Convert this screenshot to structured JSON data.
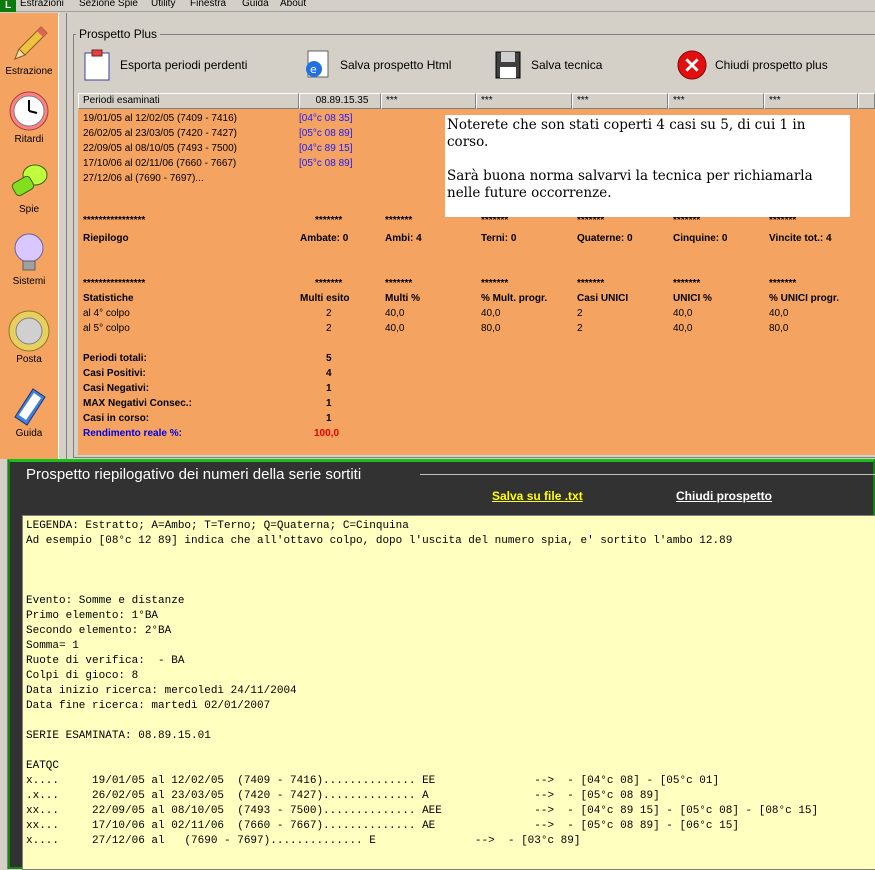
{
  "menu": {
    "items": [
      "Estrazioni",
      "Sezione Spie",
      "Utility",
      "Finestra",
      "Guida",
      "About"
    ]
  },
  "sidebar": {
    "items": [
      {
        "label": "Estrazione",
        "icon": "pencil-icon"
      },
      {
        "label": "Ritardi",
        "icon": "clock-icon"
      },
      {
        "label": "Spie",
        "icon": "flashlight-icon"
      },
      {
        "label": "Sistemi",
        "icon": "lightbulb-icon"
      },
      {
        "label": "Posta",
        "icon": "coin-icon"
      },
      {
        "label": "Guida",
        "icon": "book-icon"
      }
    ]
  },
  "prospetto": {
    "title": "Prospetto Plus",
    "toolbar": {
      "export_label": "Esporta periodi perdenti",
      "save_html_label": "Salva prospetto Html",
      "save_tech_label": "Salva tecnica",
      "close_label": "Chiudi prospetto plus"
    },
    "headers": [
      "Periodi esaminati",
      "08.89.15.35",
      "***",
      "***",
      "***",
      "***",
      "***"
    ],
    "periods": [
      {
        "range": "19/01/05 al 12/02/05  (7409 - 7416)",
        "result": "[04°c 08 35]"
      },
      {
        "range": "26/02/05 al 23/03/05  (7420 - 7427)",
        "result": "[05°c 08 89]"
      },
      {
        "range": "22/09/05 al 08/10/05  (7493 - 7500)",
        "result": "[04°c 89 15]"
      },
      {
        "range": "17/10/06 al 02/11/06  (7660 - 7667)",
        "result": "[05°c 08 89]"
      },
      {
        "range": "27/12/06 al    (7690 - 7697)...",
        "result": ""
      }
    ],
    "note": {
      "line1": "Noterete che son stati coperti 4 casi su 5, di cui 1 in corso.",
      "line2": "Sarà buona norma salvarvi la tecnica per richiamarla nelle future occorrenze."
    },
    "stars_long": "****************",
    "stars_short": "*******",
    "riepilogo": {
      "label": "Riepilogo",
      "ambate": "Ambate: 0",
      "ambi": "Ambi: 4",
      "terni": "Terni: 0",
      "quaterne": "Quaterne: 0",
      "cinquine": "Cinquine: 0",
      "vincite": "Vincite tot.: 4"
    },
    "statistiche": {
      "headers": [
        "Statistiche",
        "Multi esito",
        "Multi %",
        "% Mult. progr.",
        "Casi UNICI",
        "UNICI %",
        "% UNICI progr."
      ],
      "rows": [
        [
          "al 4° colpo",
          "2",
          "40,0",
          "40,0",
          "2",
          "40,0",
          "40,0"
        ],
        [
          "al 5° colpo",
          "2",
          "40,0",
          "80,0",
          "2",
          "40,0",
          "80,0"
        ]
      ]
    },
    "totals": [
      {
        "label": "Periodi totali:",
        "value": "5"
      },
      {
        "label": "Casi Positivi:",
        "value": "4"
      },
      {
        "label": "Casi Negativi:",
        "value": "1"
      },
      {
        "label": "MAX Negativi Consec.:",
        "value": "1"
      },
      {
        "label": "Casi in corso:",
        "value": "1"
      }
    ],
    "rendimento": {
      "label": "Rendimento reale %:",
      "value": "100,0"
    }
  },
  "riepilogativo": {
    "title": "Prospetto riepilogativo dei numeri della serie sortiti",
    "save_label": "Salva su file .txt",
    "close_label": "Chiudi prospetto",
    "text": "LEGENDA: Estratto; A=Ambo; T=Terno; Q=Quaterna; C=Cinquina\nAd esempio [08°c 12 89] indica che all'ottavo colpo, dopo l'uscita del numero spia, e' sortito l'ambo 12.89\n\n\n\nEvento: Somme e distanze\nPrimo elemento: 1°BA\nSecondo elemento: 2°BA\nSomma= 1\nRuote di verifica:  - BA\nColpi di gioco: 8\nData inizio ricerca: mercoledì 24/11/2004\nData fine ricerca: martedì 02/01/2007\n\nSERIE ESAMINATA: 08.89.15.01\n\nEATQC\nx....     19/01/05 al 12/02/05  (7409 - 7416).............. EE               -->  - [04°c 08] - [05°c 01]\n.x...     26/02/05 al 23/03/05  (7420 - 7427).............. A                -->  - [05°c 08 89]\nxx...     22/09/05 al 08/10/05  (7493 - 7500).............. AEE              -->  - [04°c 89 15] - [05°c 08] - [08°c 15]\nxx...     17/10/06 al 02/11/06  (7660 - 7667).............. AE               -->  - [05°c 08 89] - [06°c 15]\nx....     27/12/06 al   (7690 - 7697).............. E               -->  - [03°c 89]"
  }
}
